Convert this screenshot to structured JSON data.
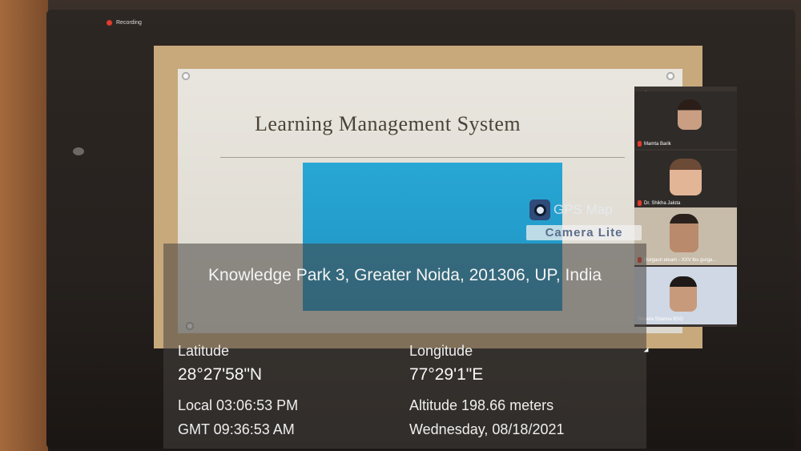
{
  "recording": {
    "label": "Recording"
  },
  "slide": {
    "title": "Learning Management System"
  },
  "participants": [
    {
      "name": "Mamta Barik"
    },
    {
      "name": "Dr. Shikha Jalota"
    },
    {
      "name": "Durgaon elearn - XXV tbs gurga..."
    },
    {
      "name": "Shweta Sharma BSG"
    }
  ],
  "gps_app": {
    "name": "GPS Map",
    "badge": "Camera Lite"
  },
  "location": {
    "address": "Knowledge Park 3, Greater Noida, 201306, UP, India",
    "latitude_label": "Latitude",
    "latitude": "28°27'58\"N",
    "longitude_label": "Longitude",
    "longitude": "77°29'1\"E",
    "local_time": "Local 03:06:53 PM",
    "gmt_time": "GMT 09:36:53 AM",
    "altitude": "Altitude  198.66 meters",
    "date": "Wednesday, 08/18/2021"
  },
  "icons": [
    "record-dot-icon",
    "raise-hand-icon",
    "mic-muted-icon",
    "camera-lens-icon",
    "mouse-cursor-icon"
  ]
}
